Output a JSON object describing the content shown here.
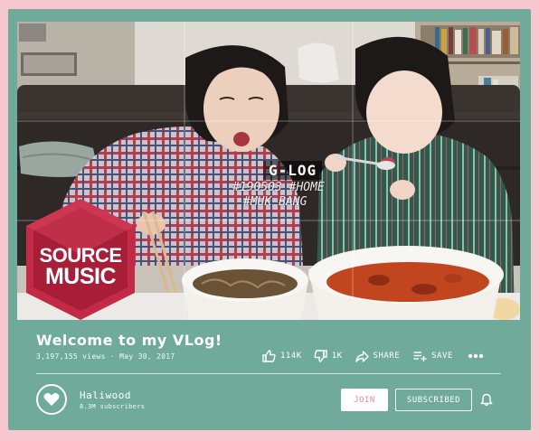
{
  "video": {
    "overlay_title": "G-LOG",
    "overlay_tag1": "#190503 #HOME",
    "overlay_tag2": "#MUK BANG",
    "logo_line1": "SOURCE",
    "logo_line2": "MUSIC"
  },
  "info": {
    "title": "Welcome to my VLog!",
    "views": "3,197,155 views",
    "separator": " · ",
    "date": "May 30, 2017"
  },
  "actions": {
    "like_count": "114K",
    "dislike_count": "1K",
    "share_label": "SHARE",
    "save_label": "SAVE"
  },
  "channel": {
    "name": "Haliwood",
    "subscribers": "8.3M subscribers",
    "join_label": "JOIN",
    "subscribed_label": "SUBSCRIBED"
  },
  "colors": {
    "page_background": "#f6c7cf",
    "card_background": "#6faa9a",
    "join_text": "#e58a9a",
    "text": "#ffffff"
  },
  "icons": [
    "thumbs-up-icon",
    "thumbs-down-icon",
    "share-icon",
    "playlist-add-icon",
    "more-icon",
    "heart-icon",
    "bell-icon"
  ]
}
